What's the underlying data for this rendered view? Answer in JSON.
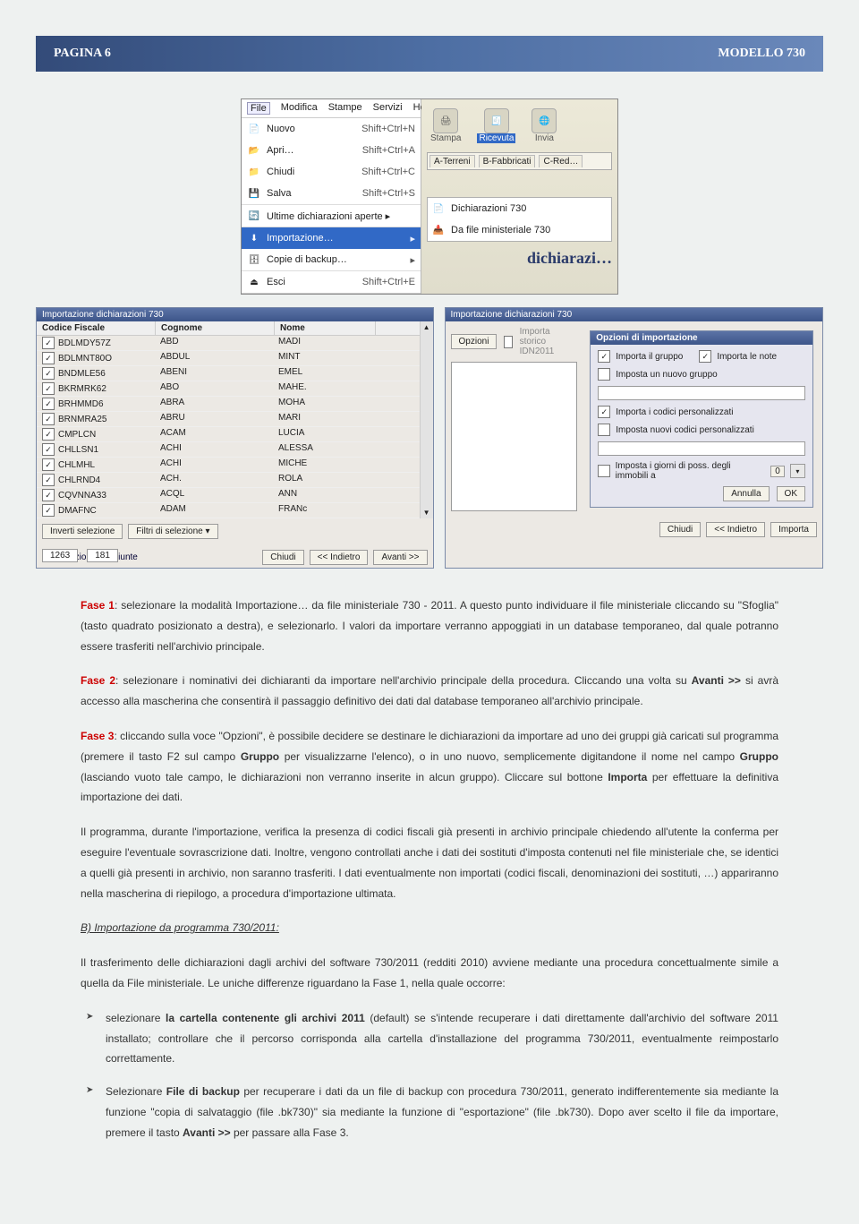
{
  "header": {
    "page_label": "PAGINA 6",
    "doc_label": "MODELLO 730"
  },
  "menubar": {
    "items": [
      "File",
      "Modifica",
      "Stampe",
      "Servizi",
      "Help"
    ]
  },
  "filemenu": {
    "nuovo": "Nuovo",
    "nuovo_cut": "Shift+Ctrl+N",
    "apri": "Apri…",
    "apri_cut": "Shift+Ctrl+A",
    "chiudi": "Chiudi",
    "chiudi_cut": "Shift+Ctrl+C",
    "salva": "Salva",
    "salva_cut": "Shift+Ctrl+S",
    "ultime": "Ultime dichiarazioni aperte  ▸",
    "import": "Importazione…",
    "backup": "Copie di backup…",
    "backup_arrow": "▸",
    "esci": "Esci",
    "esci_cut": "Shift+Ctrl+E"
  },
  "toolbar": {
    "stampa": "Stampa",
    "ricevuta": "Ricevuta",
    "invia": "Invia"
  },
  "tabs": {
    "a": "A-Terreni",
    "b": "B-Fabbricati",
    "c": "C-Red…"
  },
  "submenu": {
    "d730": "Dichiarazioni 730",
    "dafile": "Da file ministeriale 730"
  },
  "ghost_label": "dichiarazi…",
  "panel1": {
    "title": "Importazione dichiarazioni 730",
    "cols": {
      "cf": "Codice Fiscale",
      "cog": "Cognome",
      "nome": "Nome"
    },
    "rows": [
      {
        "cf": "BDLMDY57Z",
        "cog": "ABD",
        "nome": "MADI"
      },
      {
        "cf": "BDLMNT80O",
        "cog": "ABDUL",
        "nome": "MINT"
      },
      {
        "cf": "BNDMLE56",
        "cog": "ABENI",
        "nome": "EMEL"
      },
      {
        "cf": "BKRMRK62",
        "cog": "ABO",
        "nome": "MAHE."
      },
      {
        "cf": "BRHMMD6",
        "cog": "ABRA",
        "nome": "MOHA"
      },
      {
        "cf": "BRNMRA25",
        "cog": "ABRU",
        "nome": "MARI"
      },
      {
        "cf": "CMPLCN",
        "cog": "ACAM",
        "nome": "LUCIA"
      },
      {
        "cf": "CHLLSN1",
        "cog": "ACHI",
        "nome": "ALESSA"
      },
      {
        "cf": "CHLMHL",
        "cog": "ACHI",
        "nome": "MICHE"
      },
      {
        "cf": "CHLRND4",
        "cog": "ACH.",
        "nome": "ROLA"
      },
      {
        "cf": "CQVNNA33",
        "cog": "ACQL",
        "nome": "ANN"
      },
      {
        "cf": "DMAFNC",
        "cog": "ADAM",
        "nome": "FRANc"
      }
    ],
    "btn_invert": "Inverti selezione",
    "btn_filter": "Filtri di selezione ▾",
    "lbl_dich": "Dichiarazioni",
    "lbl_cong": "Congiunte",
    "cnt_dich": "1263",
    "cnt_cong": "181",
    "btn_chiudi": "Chiudi",
    "btn_indietro": "<< Indietro",
    "btn_avanti": "Avanti >>"
  },
  "panel2": {
    "title": "Importazione dichiarazioni 730",
    "btn_opzioni": "Opzioni",
    "chk_storico": "Importa storico IDN2011",
    "group_title": "Opzioni di importazione",
    "opt_gruppo": "Importa il gruppo",
    "opt_note": "Importa le note",
    "opt_nuovogrp": "Imposta un nuovo gruppo",
    "opt_codpers": "Importa i codici personalizzati",
    "opt_newcod": "Imposta nuovi codici personalizzati",
    "opt_giorni": "Imposta i giorni di poss. degli immobili a",
    "giorni_val": "0",
    "btn_annulla": "Annulla",
    "btn_ok": "OK",
    "btn_chiudi": "Chiudi",
    "btn_indietro": "<< Indietro",
    "btn_importa": "Importa"
  },
  "text": {
    "p1a": "Fase 1",
    "p1b": ": selezionare la modalità Importazione… da file ministeriale 730 - 2011. A questo punto individuare il file ministeriale cliccando su \"Sfoglia\" (tasto quadrato posizionato a destra), e selezionarlo. I valori da importare verranno appoggiati in un database temporaneo, dal quale potranno essere trasferiti nell'archivio principale.",
    "p2a": "Fase 2",
    "p2b": ": selezionare i nominativi dei dichiaranti da importare nell'archivio principale della procedura. Cliccando una volta su ",
    "p2c": "Avanti >>",
    "p2d": " si avrà accesso alla mascherina che consentirà il passaggio definitivo dei dati dal database temporaneo all'archivio principale.",
    "p3a": "Fase 3",
    "p3b": ": cliccando sulla voce \"Opzioni\", è possibile decidere se destinare le dichiarazioni da importare ad uno dei gruppi già caricati sul programma (premere il tasto F2 sul campo ",
    "p3c": "Gruppo",
    "p3d": " per visualizzarne l'elenco), o in uno nuovo, semplicemente digitandone il nome nel campo ",
    "p3e": "Gruppo",
    "p3f": " (lasciando vuoto tale campo, le dichiarazioni non verranno inserite in alcun gruppo). Cliccare sul bottone ",
    "p3g": "Importa",
    "p3h": " per effettuare la definitiva importazione dei dati.",
    "p4": "Il programma, durante l'importazione, verifica la presenza di  codici fiscali già presenti in archivio principale chiedendo all'utente la conferma per eseguire l'eventuale sovrascrizione dati. Inoltre, vengono controllati anche i dati dei sostituti d'imposta contenuti nel file ministeriale che, se identici a quelli già presenti in archivio, non saranno trasferiti. I dati eventualmente non importati (codici fiscali, denominazioni dei sostituti, …)  appariranno nella mascherina di riepilogo, a procedura d'importazione ultimata.",
    "hB": "B) Importazione da programma 730/2011:",
    "pB": "Il trasferimento delle dichiarazioni dagli archivi del software 730/2011 (redditi 2010) avviene mediante una procedura concettualmente simile a quella da File ministeriale. Le uniche differenze  riguardano la Fase 1, nella quale occorre:",
    "li1a": "selezionare ",
    "li1b": "la cartella contenente gli archivi 2011",
    "li1c": " (default) se s'intende recuperare i dati direttamente dall'archivio del software 2011 installato; controllare che il percorso  corrisponda alla cartella d'installazione del programma 730/2011, eventualmente reimpostarlo correttamente.",
    "li2a": "Selezionare ",
    "li2b": "File di backup",
    "li2c": " per recuperare i dati  da un file di backup con  procedura 730/2011, generato indifferentemente sia mediante la funzione \"copia di salvataggio (file .bk730)\" sia mediante la funzione di \"esportazione\" (file .bk730). Dopo aver scelto il file  da importare, premere  il tasto ",
    "li2d": "Avanti >>",
    "li2e": " per  passare alla Fase 3."
  }
}
